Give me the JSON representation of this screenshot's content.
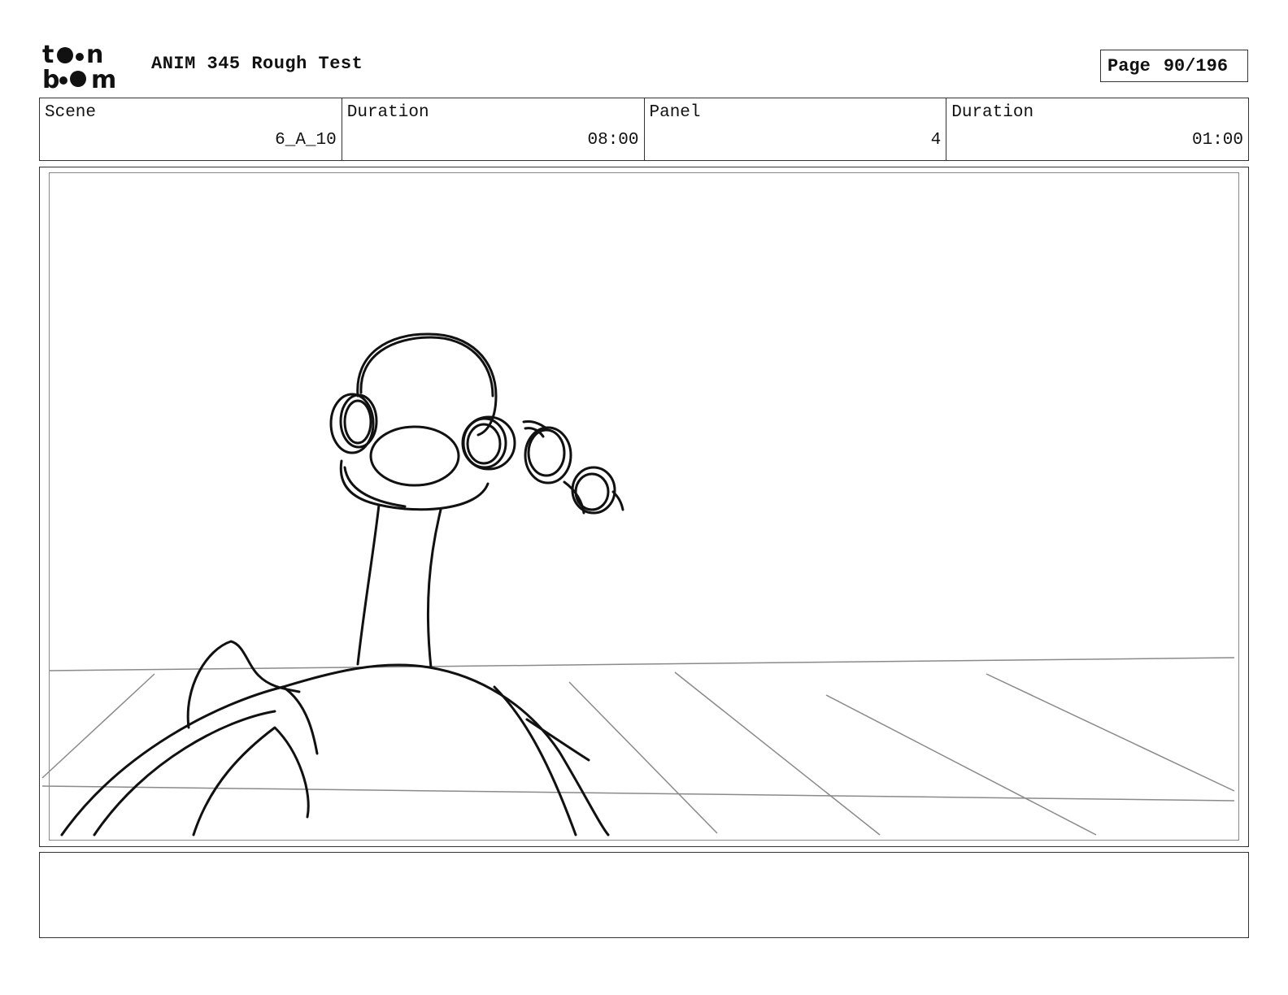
{
  "header": {
    "logo_alt": "toon boom",
    "project_title": "ANIM 345 Rough Test",
    "page_label": "Page",
    "page_number": "90/196"
  },
  "info": {
    "scene_label": "Scene",
    "scene_value": "6_A_10",
    "scene_duration_label": "Duration",
    "scene_duration_value": "08:00",
    "panel_label": "Panel",
    "panel_value": "4",
    "panel_duration_label": "Duration",
    "panel_duration_value": "01:00"
  },
  "notes": {
    "text": ""
  },
  "colors": {
    "ink": "#111111",
    "guide": "#8a8a8a",
    "border": "#333333"
  }
}
